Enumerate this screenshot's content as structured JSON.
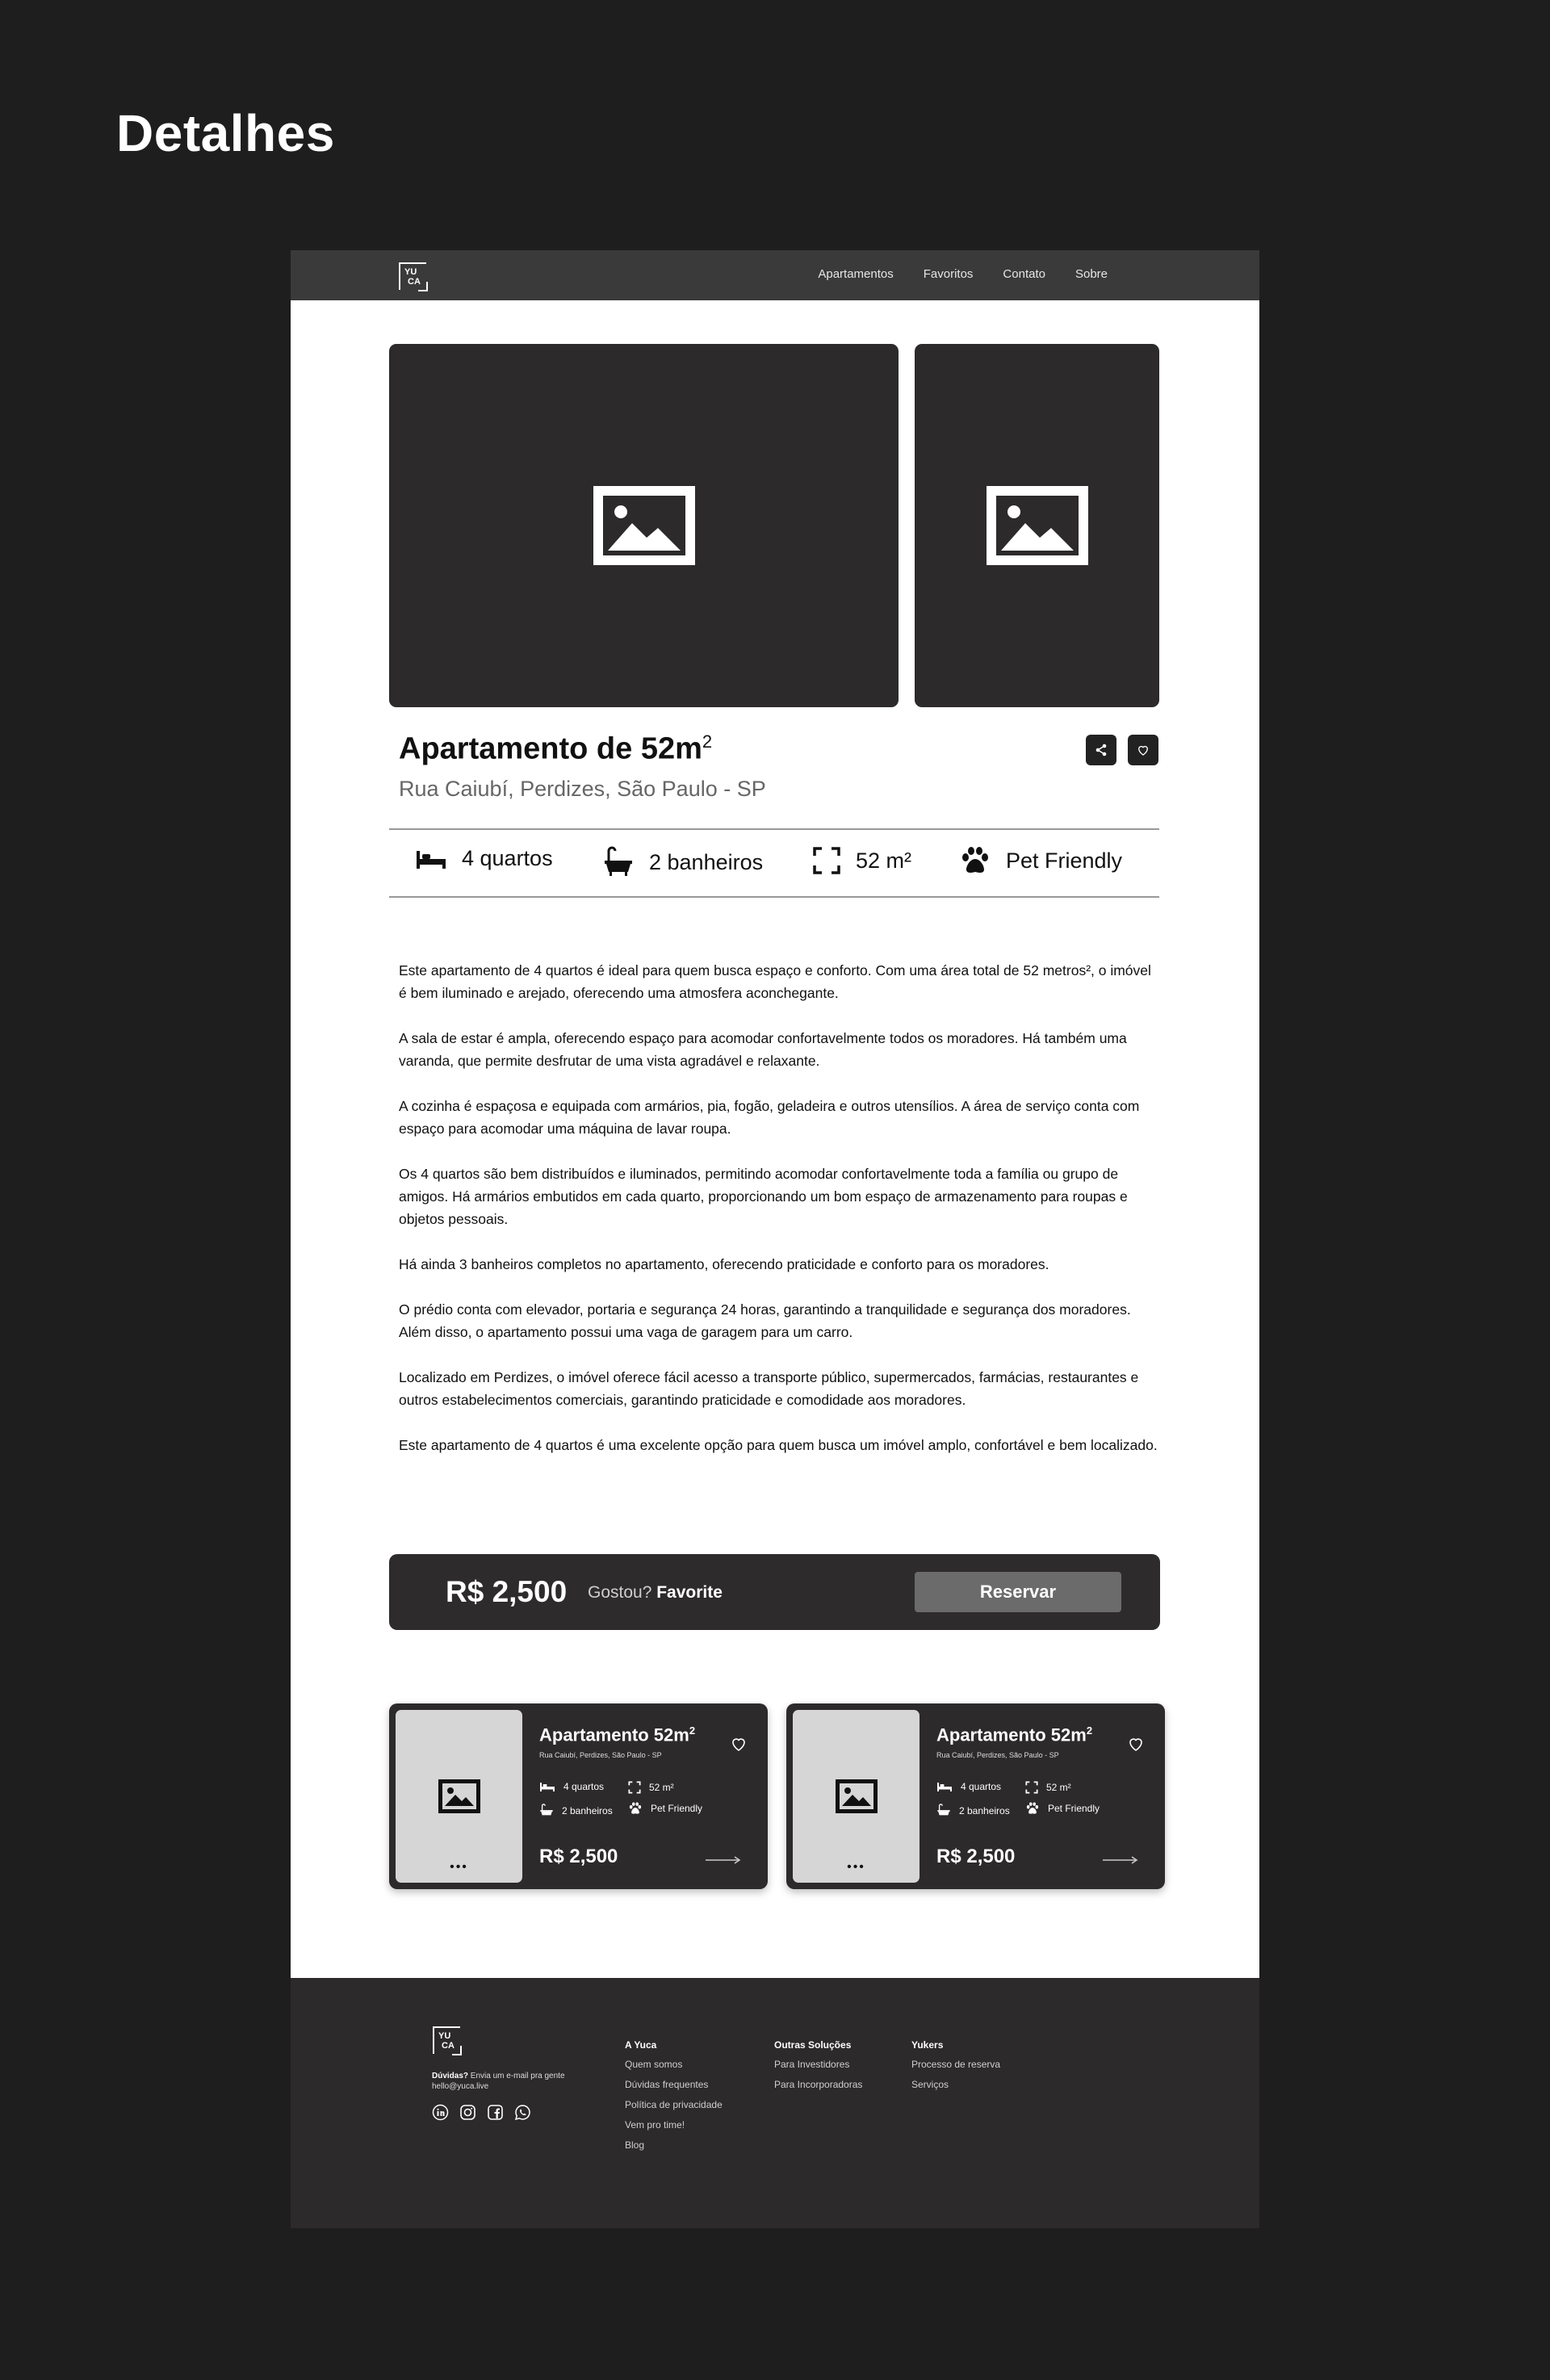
{
  "page_heading": "Detalhes",
  "nav": {
    "logo": {
      "l1": "YU",
      "l2": "CA"
    },
    "links": [
      "Apartamentos",
      "Favoritos",
      "Contato",
      "Sobre"
    ]
  },
  "listing": {
    "title": "Apartamento de 52m",
    "title_sup": "2",
    "address": "Rua Caiubí, Perdizes, São Paulo - SP",
    "features": {
      "bedrooms": "4 quartos",
      "bathrooms": "2 banheiros",
      "area": "52 m²",
      "pet": "Pet Friendly"
    },
    "description": [
      "Este apartamento de 4 quartos é ideal para quem busca espaço e conforto. Com uma área total de 52 metros², o imóvel é bem iluminado e arejado, oferecendo uma atmosfera aconchegante.",
      "A sala de estar é ampla, oferecendo espaço para acomodar confortavelmente todos os moradores. Há também uma varanda, que permite desfrutar de uma vista agradável e relaxante.",
      "A cozinha é espaçosa e equipada com armários, pia, fogão, geladeira e outros utensílios. A área de serviço conta com espaço para acomodar uma máquina de lavar roupa.",
      "Os 4 quartos são bem distribuídos e iluminados, permitindo acomodar confortavelmente toda a família ou grupo de amigos. Há armários embutidos em cada quarto, proporcionando um bom espaço de armazenamento para roupas e objetos pessoais.",
      "Há ainda 3 banheiros completos no apartamento, oferecendo praticidade e conforto para os moradores.",
      "O prédio conta com elevador, portaria e segurança 24 horas, garantindo a tranquilidade e segurança dos moradores. Além disso, o apartamento possui uma vaga de garagem para um carro.",
      "Localizado em Perdizes, o imóvel oferece fácil acesso a transporte público, supermercados, farmácias, restaurantes e outros estabelecimentos comerciais, garantindo praticidade e comodidade aos moradores.",
      "Este apartamento de 4 quartos é uma excelente opção para quem busca um imóvel amplo, confortável e bem localizado."
    ]
  },
  "pricebar": {
    "price": "R$ 2,500",
    "liked_prefix": "Gostou?",
    "liked_action": "Favorite",
    "reserve": "Reservar"
  },
  "cards": [
    {
      "title": "Apartamento 52m",
      "title_sup": "2",
      "address": "Rua Caiubí, Perdizes, São Paulo - SP",
      "bedrooms": "4 quartos",
      "area": "52 m²",
      "bathrooms": "2 banheiros",
      "pet": "Pet Friendly",
      "price": "R$ 2,500",
      "dots": "•••"
    },
    {
      "title": "Apartamento 52m",
      "title_sup": "2",
      "address": "Rua Caiubí, Perdizes, São Paulo - SP",
      "bedrooms": "4 quartos",
      "area": "52 m²",
      "bathrooms": "2 banheiros",
      "pet": "Pet Friendly",
      "price": "R$ 2,500",
      "dots": "•••"
    }
  ],
  "footer": {
    "logo": {
      "l1": "YU",
      "l2": "CA"
    },
    "contact_label": "Dúvidas?",
    "contact_text": "Envia um e-mail pra gente",
    "contact_email": "hello@yuca.live",
    "columns": [
      {
        "heading": "A Yuca",
        "links": [
          "Quem somos",
          "Dúvidas frequentes",
          "Política de privacidade",
          "Vem pro time!",
          "Blog"
        ]
      },
      {
        "heading": "Outras Soluções",
        "links": [
          "Para Investidores",
          "Para Incorporadoras"
        ]
      },
      {
        "heading": "Yukers",
        "links": [
          "Processo de reserva",
          "Serviços"
        ]
      }
    ]
  },
  "colors": {
    "page_bg": "#1e1e1e",
    "dark_panel": "#2c2a2b",
    "nav_bg": "#3a3a3a",
    "button_gray": "#6b6b6b"
  }
}
